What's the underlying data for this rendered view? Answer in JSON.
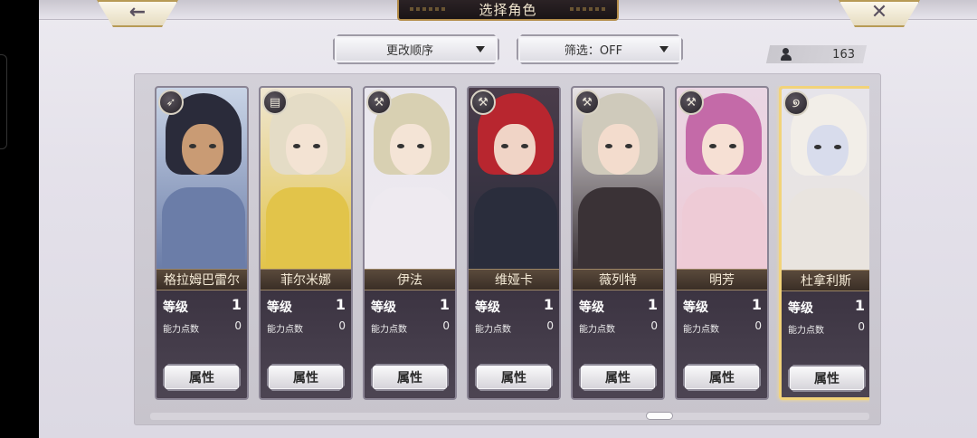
{
  "header": {
    "title": "选择角色",
    "back_icon": "←",
    "close_icon": "✕"
  },
  "toolbar": {
    "sort_label": "更改顺序",
    "filter_label": "筛选：OFF",
    "owned_count": "163"
  },
  "labels": {
    "level": "等级",
    "ability_points": "能力点数",
    "attributes_button": "属性"
  },
  "characters": [
    {
      "name": "格拉姆巴雷尔",
      "level": "1",
      "ability_points": "0",
      "class_icon": "arrow-icon",
      "icon_glyph": "➶",
      "hair": "#2a2b3a",
      "skin": "#c99b74",
      "body": "#6b7da8",
      "bg": "#c9d4e6",
      "selected": false
    },
    {
      "name": "菲尔米娜",
      "level": "1",
      "ability_points": "0",
      "class_icon": "spellbook-icon",
      "icon_glyph": "▤",
      "hair": "#e4dcc6",
      "skin": "#f3e3d3",
      "body": "#e2c44a",
      "bg": "#efe6d2",
      "selected": false
    },
    {
      "name": "伊法",
      "level": "1",
      "ability_points": "0",
      "class_icon": "hammer-icon",
      "icon_glyph": "⚒",
      "hair": "#d8d0b2",
      "skin": "#f4e4d6",
      "body": "#eeeaf0",
      "bg": "#e9e7ee",
      "selected": false
    },
    {
      "name": "维娅卡",
      "level": "1",
      "ability_points": "0",
      "class_icon": "hammer-icon",
      "icon_glyph": "⚒",
      "hair": "#b8262f",
      "skin": "#f0d4c6",
      "body": "#2a2d3c",
      "bg": "#4a3c4a",
      "selected": false
    },
    {
      "name": "薇列特",
      "level": "1",
      "ability_points": "0",
      "class_icon": "hammer-icon",
      "icon_glyph": "⚒",
      "hair": "#cfcabb",
      "skin": "#f3dccd",
      "body": "#3a3236",
      "bg": "#e7e3e6",
      "selected": false
    },
    {
      "name": "明芳",
      "level": "1",
      "ability_points": "0",
      "class_icon": "hammer-icon",
      "icon_glyph": "⚒",
      "hair": "#c46aa8",
      "skin": "#f6e0d4",
      "body": "#eecbd6",
      "bg": "#ead6e4",
      "selected": false
    },
    {
      "name": "杜拿利斯",
      "level": "1",
      "ability_points": "0",
      "class_icon": "spiral-icon",
      "icon_glyph": "୭",
      "hair": "#f2eee8",
      "skin": "#d8dcec",
      "body": "#e9e4df",
      "bg": "#e6e4ea",
      "selected": true
    }
  ]
}
